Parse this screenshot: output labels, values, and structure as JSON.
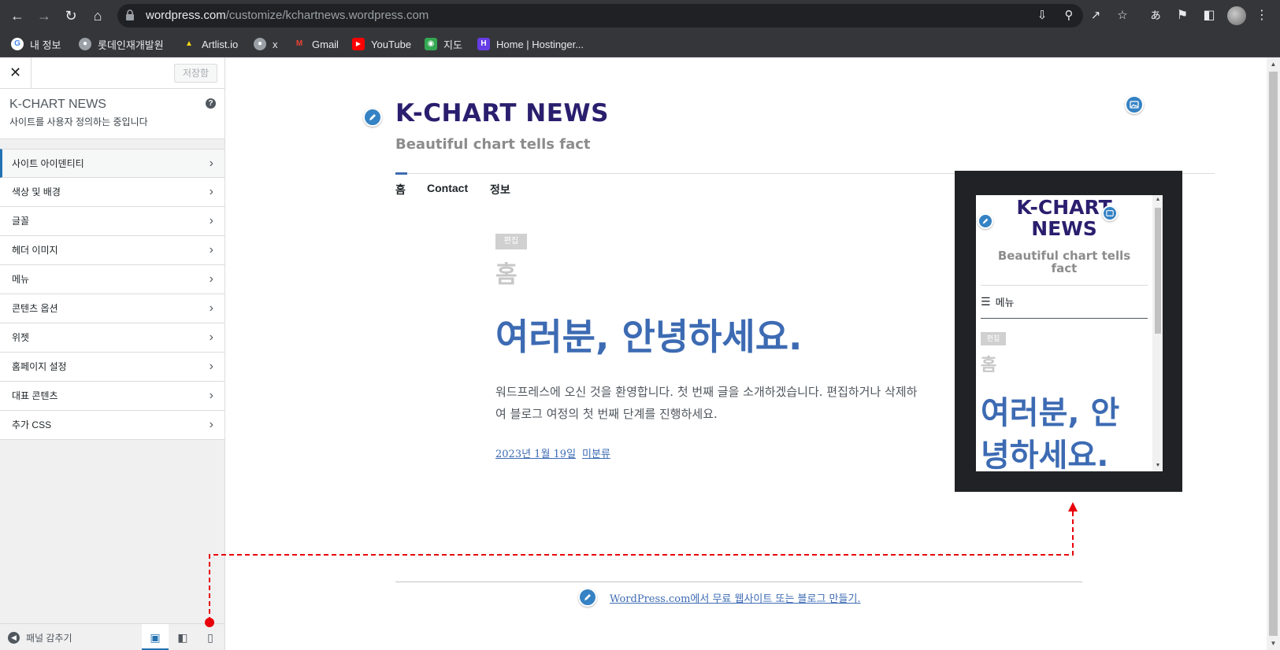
{
  "browser": {
    "url_host": "wordpress.com",
    "url_path": "/customize/kchartnews.wordpress.com",
    "bookmarks": [
      {
        "label": "내 정보",
        "icon": "google-icon",
        "color": "#4285f4"
      },
      {
        "label": "롯데인재개발원",
        "icon": "globe-icon",
        "color": "#9aa0a6"
      },
      {
        "label": "Artlist.io",
        "icon": "artlist-icon",
        "color": "#f7d716"
      },
      {
        "label": "x",
        "icon": "globe-icon",
        "color": "#9aa0a6"
      },
      {
        "label": "Gmail",
        "icon": "gmail-icon",
        "color": "#ea4335"
      },
      {
        "label": "YouTube",
        "icon": "youtube-icon",
        "color": "#ff0000"
      },
      {
        "label": "지도",
        "icon": "maps-icon",
        "color": "#34a853"
      },
      {
        "label": "Home | Hostinger...",
        "icon": "hostinger-icon",
        "color": "#673de6"
      }
    ]
  },
  "customizer": {
    "save_label": "저장함",
    "site_name": "K-CHART NEWS",
    "subtitle": "사이트를 사용자 정의하는 중입니다",
    "menu": [
      "사이트 아이덴티티",
      "색상 및 배경",
      "글꼴",
      "헤더 이미지",
      "메뉴",
      "콘텐츠 옵션",
      "위젯",
      "홈페이지 설정",
      "대표 콘텐츠",
      "추가 CSS"
    ],
    "collapse_label": "패널 감추기",
    "devices": [
      "desktop",
      "tablet",
      "mobile"
    ]
  },
  "preview": {
    "site_title": "K-CHART NEWS",
    "site_description": "Beautiful chart tells fact",
    "nav": [
      "홈",
      "Contact",
      "정보"
    ],
    "edit_tag": "편집",
    "page_title": "홈",
    "heading": "여러분, 안녕하세요.",
    "body_line1": "워드프레스에 오신 것을 환영합니다. 첫 번째 글을 소개하겠습니다. 편집하거나 삭제하",
    "body_line2": "여 블로그 여정의 첫 번째 단계를 진행하세요.",
    "date": "2023년 1월 19일",
    "category": "미분류",
    "footer_link": "WordPress.com에서 무료 웹사이트 또는 블로그 만들기."
  },
  "mobile_preview": {
    "title_line1": "K-CHART",
    "title_line2": "NEWS",
    "desc_line1": "Beautiful chart tells",
    "desc_line2": "fact",
    "menu_label": "메뉴",
    "edit_tag": "편집",
    "page_title": "홈",
    "heading_line1": "여러분, 안",
    "heading_line2": "녕하세요."
  },
  "colors": {
    "accent": "#3d6bb3",
    "title": "#2a1e6e",
    "annotation": "#e8000b"
  }
}
